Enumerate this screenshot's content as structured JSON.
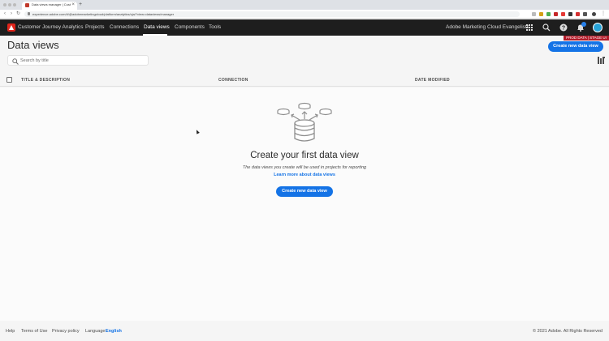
{
  "browser": {
    "tab_title": "Data views manager | Custom",
    "url": "experience.adobe.com/#/@adobemarketingcloud/platform/analytics/cja/?view=dataviews/manager"
  },
  "app": {
    "title": "Customer Journey Analytics",
    "nav": [
      "Projects",
      "Connections",
      "Data views",
      "Components",
      "Tools"
    ],
    "active_nav": "Data views",
    "org_name": "Adobe Marketing Cloud Evangelists",
    "env_badge": "PROD DATA | STAGE UI"
  },
  "page": {
    "title": "Data views",
    "create_button": "Create new data view",
    "search_placeholder": "Search by title"
  },
  "table": {
    "headers": [
      "TITLE & DESCRIPTION",
      "CONNECTION",
      "DATE MODIFIED"
    ],
    "sort_indicator": "↓"
  },
  "empty_state": {
    "title": "Create your first data view",
    "description": "The data views you create will be used in projects for reporting",
    "link": "Learn more about data views",
    "button": "Create new data view"
  },
  "footer": {
    "links": [
      "Help",
      "Terms of Use",
      "Privacy policy"
    ],
    "language_label": "Language:",
    "language_value": "English",
    "copyright": "© 2021 Adobe. All Rights Reserved"
  },
  "colors": {
    "accent": "#1473e6",
    "header_bg": "#1e1e1e",
    "adobe_red": "#e1251b",
    "env_badge": "#b11b29"
  },
  "icons": [
    "adobe-logo-icon",
    "apps-grid-icon",
    "search-icon",
    "help-icon",
    "notifications-icon",
    "column-settings-icon",
    "data-view-illustration"
  ]
}
